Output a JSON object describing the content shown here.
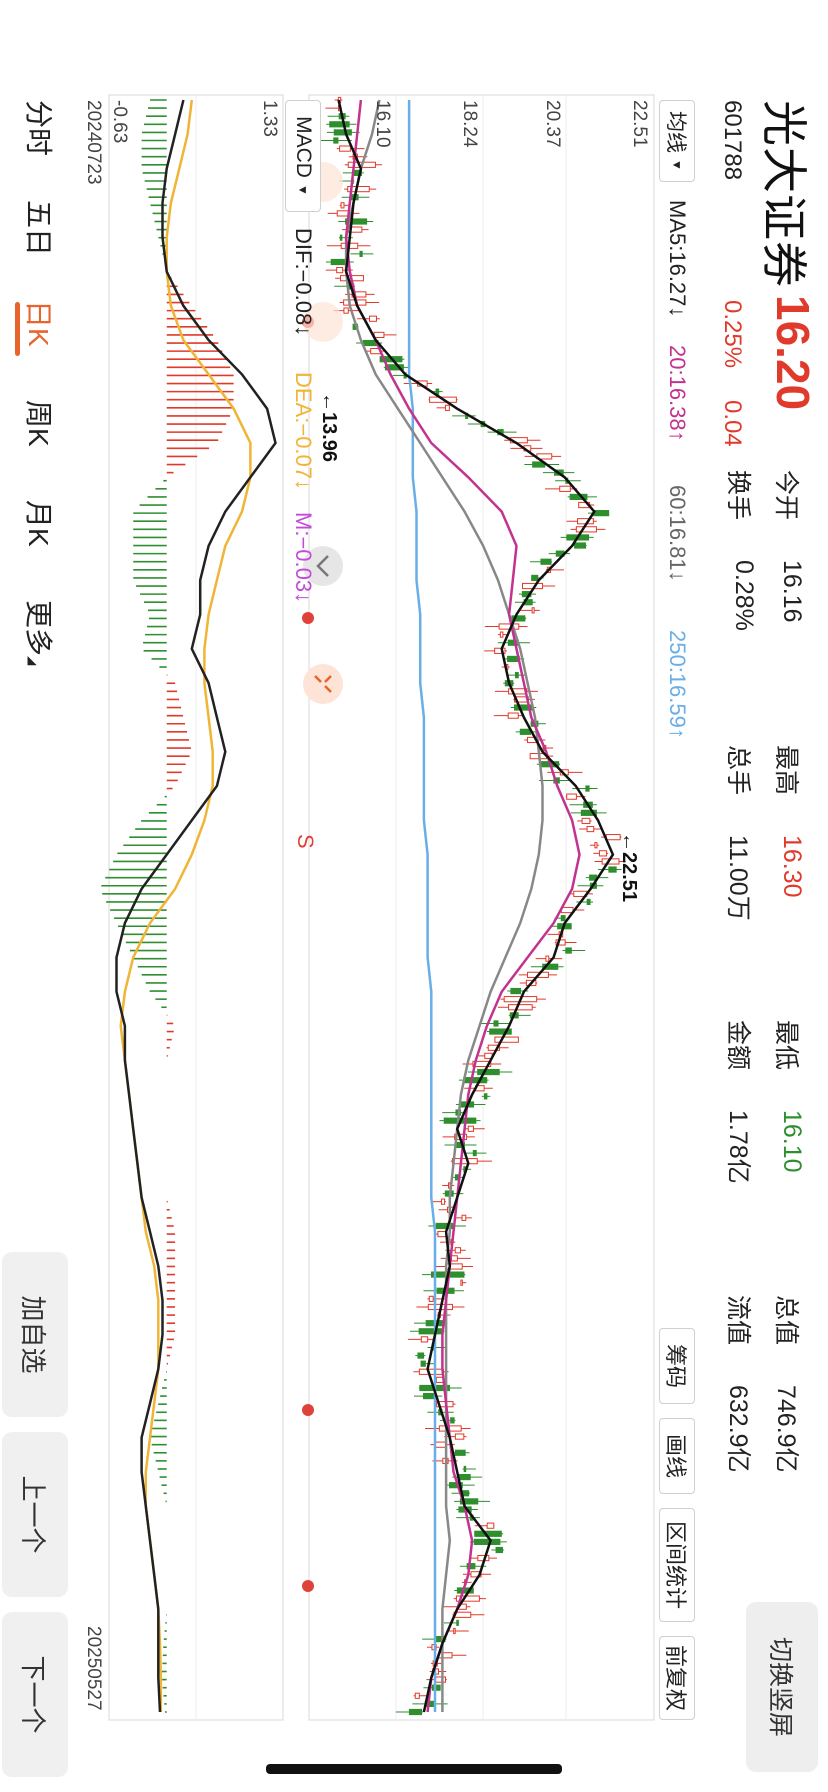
{
  "header": {
    "name": "光大证券",
    "price": "16.20",
    "code": "601788",
    "change_pct": "0.25%",
    "change": "0.04",
    "stats": [
      {
        "label": "今开",
        "value": "16.16",
        "color": "#222222"
      },
      {
        "label": "换手",
        "value": "0.28%",
        "color": "#222222"
      },
      {
        "label": "最高",
        "value": "16.30",
        "color": "#e03a2b"
      },
      {
        "label": "总手",
        "value": "11.00万",
        "color": "#222222"
      },
      {
        "label": "最低",
        "value": "16.10",
        "color": "#2f8f2f"
      },
      {
        "label": "金额",
        "value": "1.78亿",
        "color": "#222222"
      },
      {
        "label": "总值",
        "value": "746.9亿",
        "color": "#222222"
      },
      {
        "label": "流值",
        "value": "632.9亿",
        "color": "#222222"
      }
    ],
    "switch_label": "切换竖屏"
  },
  "toolbar": {
    "ma_select": "均线",
    "ma_values": [
      {
        "text": "MA5:16.27↓",
        "color": "#222222"
      },
      {
        "text": "20:16.38↑",
        "color": "#c2338f"
      },
      {
        "text": "60:16.81↓",
        "color": "#666666"
      },
      {
        "text": "250:16.59↑",
        "color": "#6aaee8"
      }
    ],
    "tools": [
      "筹码",
      "画线",
      "区间统计",
      "前复权"
    ]
  },
  "price_axis": [
    "22.51",
    "20.37",
    "18.24",
    "16.10"
  ],
  "price_notes": {
    "high": "←22.51",
    "low": "←13.96",
    "sell_mark": "S"
  },
  "indicator": {
    "name": "MACD",
    "dif": "DIF:−0.08↓",
    "dea": "DEA:−0.07↓",
    "m": "M:−0.03↓",
    "axis_top": "1.33",
    "axis_bottom": "-0.63",
    "colors": {
      "dif": "#222222",
      "dea": "#f0b436",
      "m": "#c24bd8"
    }
  },
  "dates": {
    "start": "20240723",
    "end": "20250527"
  },
  "tabs": [
    "分时",
    "五日",
    "日K",
    "周K",
    "月K",
    "更多"
  ],
  "active_tab": "日K",
  "nav": [
    "加自选",
    "上一个",
    "下一个"
  ],
  "colors": {
    "up": "#e03a2b",
    "down": "#2f8f2f",
    "accent": "#e8642c",
    "ma250": "#6aaee8"
  },
  "ma_curves": {
    "ma5": [
      14.0,
      14.2,
      14.6,
      14.4,
      14.3,
      14.2,
      14.5,
      15.0,
      15.8,
      17.2,
      18.8,
      20.1,
      20.9,
      20.3,
      19.4,
      18.8,
      18.4,
      18.6,
      19.0,
      19.5,
      20.4,
      21.0,
      21.4,
      20.8,
      20.1,
      19.8,
      19.0,
      18.6,
      18.1,
      17.6,
      17.2,
      17.5,
      17.2,
      16.9,
      17.0,
      16.8,
      16.6,
      16.4,
      16.7,
      17.0,
      17.2,
      17.4,
      18.1,
      17.8,
      17.2,
      16.8,
      16.5,
      16.3
    ],
    "ma20": [
      14.6,
      14.5,
      14.4,
      14.3,
      14.2,
      14.3,
      14.5,
      15.0,
      15.4,
      15.9,
      16.5,
      17.5,
      18.4,
      18.8,
      18.7,
      18.6,
      18.8,
      19.0,
      19.2,
      19.6,
      19.9,
      20.3,
      20.5,
      20.3,
      19.8,
      19.1,
      18.4,
      18.0,
      17.7,
      17.5,
      17.4,
      17.3,
      17.2,
      17.1,
      17.0,
      16.9,
      16.8,
      16.8,
      16.9,
      17.0,
      17.1,
      17.4,
      17.6,
      17.5,
      17.2,
      16.8,
      16.5,
      16.4
    ],
    "ma60": [
      15.1,
      14.9,
      14.6,
      14.4,
      14.2,
      14.2,
      14.3,
      14.6,
      15.0,
      15.6,
      16.2,
      16.8,
      17.4,
      17.9,
      18.3,
      18.6,
      18.9,
      19.1,
      19.3,
      19.4,
      19.5,
      19.5,
      19.4,
      19.2,
      18.9,
      18.5,
      18.1,
      17.8,
      17.5,
      17.3,
      17.2,
      17.1,
      17.0,
      17.0,
      16.9,
      16.9,
      16.9,
      16.9,
      16.9,
      16.9,
      16.9,
      16.9,
      17.0,
      16.9,
      16.8,
      16.8,
      16.8,
      16.8
    ],
    "ma250": [
      15.9,
      15.9,
      15.9,
      15.9,
      15.9,
      15.9,
      15.9,
      15.9,
      15.9,
      16.0,
      16.0,
      16.0,
      16.1,
      16.1,
      16.1,
      16.2,
      16.2,
      16.2,
      16.3,
      16.3,
      16.3,
      16.3,
      16.4,
      16.4,
      16.4,
      16.4,
      16.5,
      16.5,
      16.5,
      16.5,
      16.5,
      16.5,
      16.5,
      16.6,
      16.6,
      16.6,
      16.6,
      16.6,
      16.6,
      16.6,
      16.6,
      16.6,
      16.6,
      16.6,
      16.6,
      16.6,
      16.6,
      16.6
    ]
  },
  "macd": {
    "dif": [
      0.2,
      0.1,
      0.0,
      -0.05,
      -0.05,
      0.0,
      0.2,
      0.5,
      0.9,
      1.2,
      1.3,
      1.0,
      0.7,
      0.5,
      0.4,
      0.4,
      0.3,
      0.5,
      0.6,
      0.7,
      0.6,
      0.3,
      0.0,
      -0.3,
      -0.5,
      -0.6,
      -0.6,
      -0.5,
      -0.5,
      -0.45,
      -0.4,
      -0.35,
      -0.3,
      -0.2,
      -0.1,
      -0.05,
      -0.05,
      -0.1,
      -0.2,
      -0.3,
      -0.3,
      -0.25,
      -0.2,
      -0.15,
      -0.1,
      -0.1,
      -0.1,
      -0.08
    ],
    "dea": [
      0.3,
      0.25,
      0.15,
      0.05,
      0.0,
      0.0,
      0.05,
      0.2,
      0.5,
      0.8,
      1.0,
      1.0,
      0.9,
      0.7,
      0.6,
      0.5,
      0.45,
      0.45,
      0.5,
      0.55,
      0.55,
      0.45,
      0.3,
      0.1,
      -0.2,
      -0.4,
      -0.5,
      -0.55,
      -0.5,
      -0.45,
      -0.4,
      -0.35,
      -0.3,
      -0.25,
      -0.15,
      -0.1,
      -0.1,
      -0.1,
      -0.15,
      -0.2,
      -0.25,
      -0.25,
      -0.2,
      -0.15,
      -0.1,
      -0.08,
      -0.07,
      -0.07
    ]
  }
}
